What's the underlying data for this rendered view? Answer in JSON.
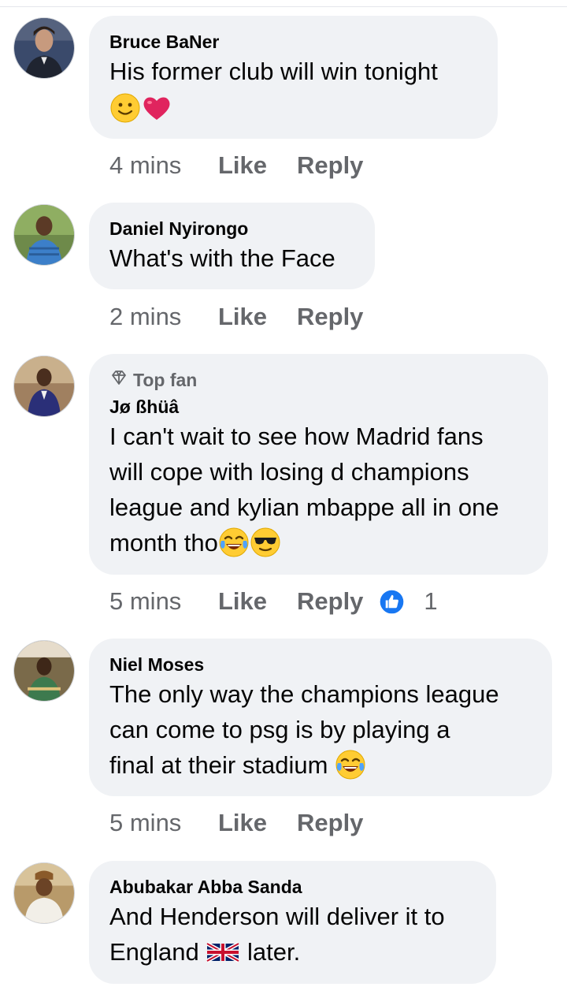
{
  "comments": [
    {
      "author": "Bruce BaNer",
      "line1": "His former club will win tonight",
      "time": "4 mins",
      "like": "Like",
      "reply": "Reply"
    },
    {
      "author": "Daniel Nyirongo",
      "line1": "What's with the Face",
      "time": "2 mins",
      "like": "Like",
      "reply": "Reply"
    },
    {
      "badge": "Top fan",
      "author": "Jø ßhüâ",
      "line1": "I can't wait to see how Madrid fans",
      "line2": "will cope with losing d champions",
      "line3": "league and kylian mbappe all in one",
      "line4": "month tho",
      "time": "5 mins",
      "like": "Like",
      "reply": "Reply",
      "reaction_count": "1"
    },
    {
      "author": "Niel Moses",
      "line1": "The only way the champions league",
      "line2": "can come to psg is by playing a",
      "line3": "final at their stadium",
      "time": "5 mins",
      "like": "Like",
      "reply": "Reply"
    },
    {
      "author": "Abubakar Abba Sanda",
      "line1": "And Henderson will deliver it to",
      "line2a": "England",
      "line2b": "later.",
      "line2b_prefix": " "
    }
  ],
  "icons": {
    "smile": "slightly-smiling-face-icon",
    "heart": "red-heart-icon",
    "laugh": "tears-of-joy-icon",
    "cool": "sunglasses-face-icon",
    "flag": "uk-flag-icon",
    "diamond": "diamond-icon",
    "thumb": "like-reaction-icon"
  },
  "colors": {
    "bubble": "#f0f2f5",
    "meta": "#65676b",
    "like_blue": "#1877f2"
  }
}
